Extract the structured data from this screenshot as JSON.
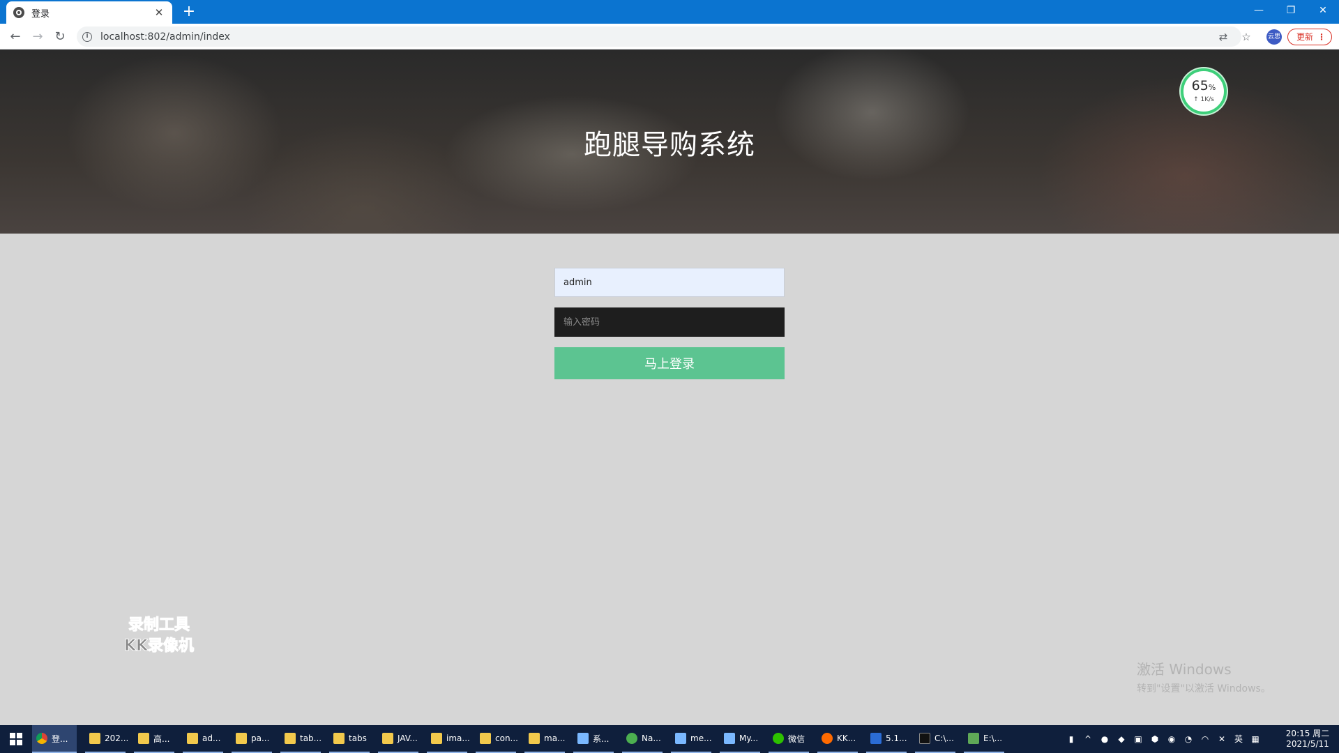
{
  "browser": {
    "tab_title": "登录",
    "url": "localhost:802/admin/index",
    "update_label": "更新",
    "profile_label": "云思"
  },
  "page": {
    "title": "跑腿导购系统",
    "username_value": "admin",
    "password_placeholder": "输入密码",
    "login_button": "马上登录"
  },
  "speed_widget": {
    "percent": "65",
    "percent_unit": "%",
    "rate": "↑ 1K/s"
  },
  "overlays": {
    "watermark_line1": "录制工具",
    "watermark_line2": "KK录像机",
    "activate_title": "激活 Windows",
    "activate_sub": "转到\"设置\"以激活 Windows。"
  },
  "taskbar": {
    "items": [
      {
        "icon": "chrome",
        "label": "登..."
      },
      {
        "icon": "folder",
        "label": "202..."
      },
      {
        "icon": "folder",
        "label": "高..."
      },
      {
        "icon": "folder",
        "label": "ad..."
      },
      {
        "icon": "folder",
        "label": "pa..."
      },
      {
        "icon": "folder",
        "label": "tab..."
      },
      {
        "icon": "folder",
        "label": "tabs"
      },
      {
        "icon": "folder",
        "label": "JAV..."
      },
      {
        "icon": "folder",
        "label": "ima..."
      },
      {
        "icon": "folder",
        "label": "con..."
      },
      {
        "icon": "folder",
        "label": "ma..."
      },
      {
        "icon": "app",
        "label": "系..."
      },
      {
        "icon": "green",
        "label": "Na..."
      },
      {
        "icon": "app",
        "label": "me..."
      },
      {
        "icon": "app",
        "label": "My..."
      },
      {
        "icon": "wechat",
        "label": "微信"
      },
      {
        "icon": "kk",
        "label": "KK..."
      },
      {
        "icon": "vs",
        "label": "5.1..."
      },
      {
        "icon": "cmd",
        "label": "C:\\..."
      },
      {
        "icon": "edit",
        "label": "E:\\..."
      }
    ],
    "ime": "英",
    "time": "20:15 周二",
    "date": "2021/5/11"
  }
}
